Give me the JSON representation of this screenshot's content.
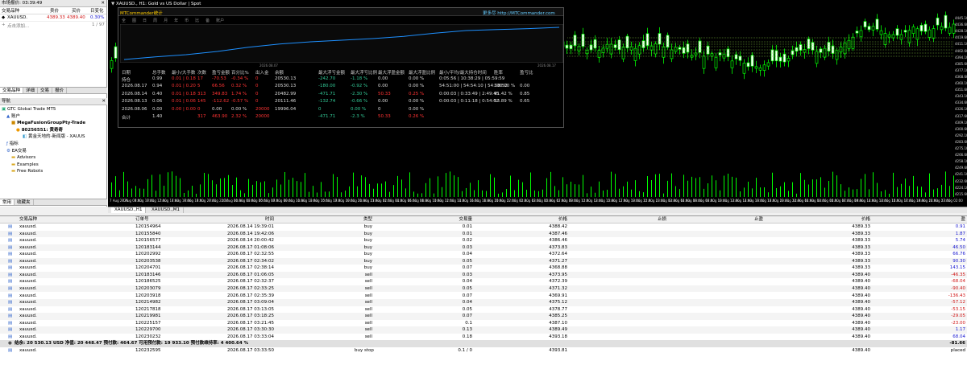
{
  "market_watch": {
    "title": "市场报价: 03:39:49",
    "headers": {
      "symbol": "交易品种",
      "bid": "卖价",
      "ask": "买价",
      "change": "日变化"
    },
    "row": {
      "symbol": "XAUUSD.",
      "bid": "4389.33",
      "ask": "4389.40",
      "change": "0.30%"
    },
    "add_label": "点击添加...",
    "count": "1 / 97",
    "tabs": [
      "交易品种",
      "详细",
      "交易",
      "报价"
    ]
  },
  "navigator": {
    "title": "导航",
    "items": [
      "GTC Global Trade MT5",
      "账户",
      "MegaFusionGroupPty-Trade",
      "80256551: 黄奇奇",
      "黄金天地的-新闻版 - XAUUS",
      "指标",
      "EA交易",
      "Advisors",
      "Examples",
      "Free Robots"
    ],
    "bottom_tabs": [
      "常用",
      "收藏夹"
    ]
  },
  "chart": {
    "title": "XAUUSD., H1:  Gold vs US Dollar | Spot",
    "price_labels": [
      "4445.10",
      "4436.60",
      "4428.10",
      "4419.60",
      "4411.10",
      "4402.60",
      "4394.10",
      "4385.60",
      "4377.10",
      "4368.60",
      "4360.10",
      "4351.60",
      "4343.10",
      "4334.60",
      "4326.10",
      "4317.60",
      "4309.10",
      "4300.60",
      "4292.10",
      "4283.60",
      "4275.10",
      "4266.60",
      "4258.10",
      "4249.60",
      "4241.10",
      "4232.60",
      "4224.10",
      "4215.60"
    ],
    "time_labels": [
      "7 Aug 2026",
      "7 Aug 08:00",
      "7 Aug 10:00",
      "7 Aug 12:00",
      "7 Aug 14:00",
      "7 Aug 16:00",
      "7 Aug 18:00",
      "7 Aug 20:00",
      "7 Aug 22:00",
      "10 Aug 01:00",
      "10 Aug 03:00",
      "10 Aug 05:00",
      "10 Aug 07:00",
      "10 Aug 09:00",
      "10 Aug 11:00",
      "10 Aug 13:00",
      "10 Aug 15:00",
      "10 Aug 17:00",
      "10 Aug 19:00",
      "10 Aug 21:00",
      "10 Aug 23:00",
      "11 Aug 02:00",
      "11 Aug 04:00",
      "11 Aug 06:00",
      "11 Aug 08:00",
      "11 Aug 10:00",
      "11 Aug 12:00",
      "11 Aug 14:00",
      "11 Aug 16:00",
      "11 Aug 18:00",
      "11 Aug 20:00",
      "11 Aug 22:00",
      "12 Aug 01:00",
      "12 Aug 03:00",
      "12 Aug 05:00",
      "12 Aug 07:00",
      "12 Aug 09:00",
      "12 Aug 11:00",
      "12 Aug 13:00",
      "12 Aug 15:00",
      "12 Aug 17:00",
      "12 Aug 19:00",
      "12 Aug 21:00",
      "12 Aug 23:00",
      "13 Aug 02:00",
      "13 Aug 04:00",
      "13 Aug 06:00",
      "13 Aug 08:00",
      "13 Aug 10:00",
      "13 Aug 12:00",
      "13 Aug 14:00",
      "13 Aug 16:00",
      "13 Aug 18:00",
      "13 Aug 20:00",
      "13 Aug 22:00",
      "14 Aug 01:00",
      "14 Aug 03:00",
      "14 Aug 05:00",
      "14 Aug 07:00",
      "14 Aug 09:00",
      "14 Aug 11:00",
      "14 Aug 13:00",
      "14 Aug 15:00",
      "14 Aug 17:00",
      "14 Aug 19:00",
      "14 Aug 21:00",
      "14 Aug 23:00",
      "17 Aug 02:00"
    ],
    "tabs": [
      "XAUUSD.,H1",
      "XAUUSD.,M1"
    ],
    "overlay": {
      "title": "MTCommander统计",
      "link": "更多尽 http://MTCommander.com",
      "date_left": "2026.08.07",
      "date_right": "2026.08.17",
      "toolbar_items": [
        "全",
        "图",
        "日",
        "周",
        "月",
        "年",
        "币",
        "比",
        "备",
        "账户"
      ],
      "headers": [
        "日期",
        "总手数",
        "最小/大手数",
        "次数",
        "盈亏金额",
        "百分比%",
        "出入金",
        "余额",
        "最大浮亏金额",
        "最大浮亏比例",
        "最大浮盈金额",
        "最大浮盈比例",
        "最小/平均/最大持仓时间",
        "胜率",
        "盈亏比"
      ],
      "rows": [
        [
          "持仓",
          "0.99",
          "0.01 | 0.18",
          "17",
          "-70.53",
          "-0.34 %",
          "0",
          "20530.13",
          "-242.70",
          "-1.18 %",
          "0.00",
          "0.00 %",
          "0:05:56 | 10:38:29 | 05:59:59",
          "",
          ""
        ],
        [
          "2026.08.17",
          "0.94",
          "0.01 | 0.20",
          "5",
          "66.56",
          "0.32 %",
          "0",
          "20530.13",
          "-180.00",
          "-0.92 %",
          "0.00",
          "0.00 %",
          "54:51:00 | 54:54:10 | 54:58:52",
          "100.00 %",
          "0.00"
        ],
        [
          "2026.08.14",
          "0.40",
          "0.01 | 0.18",
          "313",
          "349.83",
          "1.74 %",
          "0",
          "20482.99",
          "-471.71",
          "-2.30 %",
          "50.33",
          "0.25 %",
          "0:00:03 | 0:33:49 | 2:49:45",
          "91.42 %",
          "0.85"
        ],
        [
          "2026.08.13",
          "0.06",
          "0.01 | 0.06",
          "145",
          "-112.62",
          "-0.57 %",
          "0",
          "20111.46",
          "-132.74",
          "-0.66 %",
          "0.00",
          "0.00 %",
          "0:00:03 | 0:11:18 | 0:54:02",
          "53.89 %",
          "0.65"
        ],
        [
          "2026.08.06",
          "0.00",
          "0.00 | 0.00",
          "0",
          "0.00",
          "0.00 %",
          "20000",
          "19996.04",
          "0",
          "0.00 %",
          "0",
          "0.00 %",
          "",
          "",
          ""
        ],
        [
          "合计",
          "1.40",
          "",
          "317",
          "463.90",
          "2.32 %",
          "20000",
          "",
          "-471.71",
          "-2.3 %",
          "50.33",
          "0.26 %",
          "",
          "",
          ""
        ]
      ],
      "equity_curve": [
        0,
        0.08,
        0.15,
        0.25,
        0.38,
        0.48,
        0.55,
        0.6,
        0.65,
        0.72,
        0.82,
        0.9,
        0.93,
        0.96,
        1
      ]
    }
  },
  "trade": {
    "headers": [
      "交易品种",
      "订单号",
      "时间",
      "类型",
      "交易量",
      "价格",
      "止损",
      "止盈",
      "价格",
      "盈"
    ],
    "rows": [
      [
        "xauusd.",
        "120154964",
        "2026.08.14 19:39:01",
        "buy",
        "0.01",
        "4388.42",
        "",
        "",
        "4389.33",
        "0.91"
      ],
      [
        "xauusd.",
        "120155840",
        "2026.08.14 19:42:06",
        "buy",
        "0.01",
        "4387.46",
        "",
        "",
        "4389.33",
        "1.87"
      ],
      [
        "xauusd.",
        "120156577",
        "2026.08.14 20:00:42",
        "buy",
        "0.02",
        "4386.46",
        "",
        "",
        "4389.33",
        "5.74"
      ],
      [
        "xauusd.",
        "120183144",
        "2026.08.17 01:08:06",
        "buy",
        "0.03",
        "4373.83",
        "",
        "",
        "4389.33",
        "46.50"
      ],
      [
        "xauusd.",
        "120202992",
        "2026.08.17 02:32:55",
        "buy",
        "0.04",
        "4372.64",
        "",
        "",
        "4389.33",
        "66.76"
      ],
      [
        "xauusd.",
        "120203538",
        "2026.08.17 02:34:02",
        "buy",
        "0.05",
        "4371.27",
        "",
        "",
        "4389.33",
        "90.30"
      ],
      [
        "xauusd.",
        "120204701",
        "2026.08.17 02:38:14",
        "buy",
        "0.07",
        "4368.88",
        "",
        "",
        "4389.33",
        "143.15"
      ],
      [
        "xauusd.",
        "120183146",
        "2026.08.17 01:06:05",
        "sell",
        "0.03",
        "4373.95",
        "",
        "",
        "4389.40",
        "-46.35"
      ],
      [
        "xauusd.",
        "120186525",
        "2026.08.17 02:32:37",
        "sell",
        "0.04",
        "4372.39",
        "",
        "",
        "4389.40",
        "-68.04"
      ],
      [
        "xauusd.",
        "120203079",
        "2026.08.17 02:33:25",
        "sell",
        "0.05",
        "4371.32",
        "",
        "",
        "4389.40",
        "-90.40"
      ],
      [
        "xauusd.",
        "120203918",
        "2026.08.17 02:35:39",
        "sell",
        "0.07",
        "4369.91",
        "",
        "",
        "4389.40",
        "-136.43"
      ],
      [
        "xauusd.",
        "120214982",
        "2026.08.17 03:09:04",
        "sell",
        "0.04",
        "4375.12",
        "",
        "",
        "4389.40",
        "-57.12"
      ],
      [
        "xauusd.",
        "120217818",
        "2026.08.17 03:13:05",
        "sell",
        "0.05",
        "4378.77",
        "",
        "",
        "4389.40",
        "-53.15"
      ],
      [
        "xauusd.",
        "120219981",
        "2026.08.17 03:18:25",
        "sell",
        "0.07",
        "4385.25",
        "",
        "",
        "4389.40",
        "-29.05"
      ],
      [
        "xauusd.",
        "120225157",
        "2026.08.17 03:21:45",
        "sell",
        "0.1",
        "4387.10",
        "",
        "",
        "4389.40",
        "-23.00"
      ],
      [
        "xauusd.",
        "120229700",
        "2026.08.17 03:30:30",
        "sell",
        "0.13",
        "4389.49",
        "",
        "",
        "4389.40",
        "1.17"
      ],
      [
        "xauusd.",
        "120230232",
        "2026.08.17 03:33:04",
        "sell",
        "0.18",
        "4393.18",
        "",
        "",
        "4389.40",
        "68.04"
      ]
    ],
    "summary": {
      "text": "结余: 20 530.13 USD  净值: 20 448.47  预付款: 464.67  可用预付款: 19 933.10  预付款维持率: 4 400.64 %",
      "profit": "-81.66"
    },
    "pending": [
      "xauusd.",
      "120232595",
      "2026.08.17 03:33:50",
      "buy stop",
      "0.1 / 0",
      "4393.81",
      "",
      "",
      "4389.40",
      "placed"
    ]
  },
  "colors": {
    "up": "#ffffff",
    "down": "#000000",
    "candle_line": "#00ff00",
    "curve": "#1e90ff",
    "profit_pos": "#1515d0",
    "profit_neg": "#d01515"
  }
}
